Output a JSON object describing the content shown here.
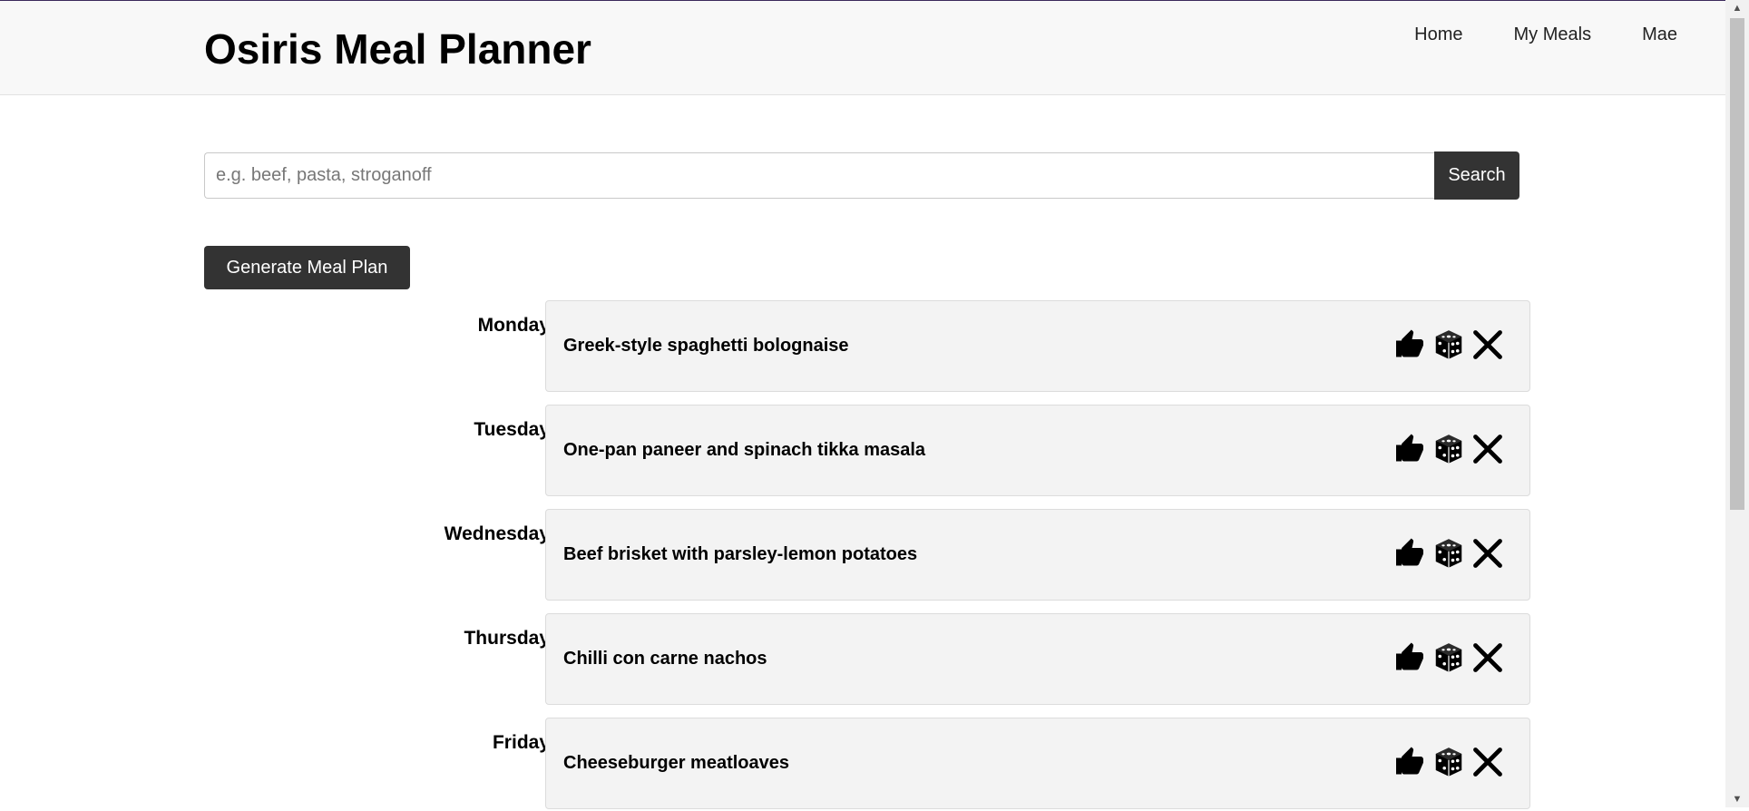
{
  "header": {
    "title": "Osiris Meal Planner",
    "nav": [
      "Home",
      "My Meals",
      "Mae"
    ]
  },
  "search": {
    "placeholder": "e.g. beef, pasta, stroganoff",
    "value": "",
    "button_label": "Search"
  },
  "generate_button": "Generate Meal Plan",
  "plan": [
    {
      "day": "Monday:",
      "meal": "Greek-style spaghetti bolognaise"
    },
    {
      "day": "Tuesday:",
      "meal": "One-pan paneer and spinach tikka masala"
    },
    {
      "day": "Wednesday:",
      "meal": "Beef brisket with parsley-lemon potatoes"
    },
    {
      "day": "Thursday:",
      "meal": "Chilli con carne nachos"
    },
    {
      "day": "Friday:",
      "meal": "Cheeseburger meatloaves"
    }
  ],
  "icons": {
    "like": "thumbs-up-icon",
    "reroll": "dice-icon",
    "remove": "close-icon"
  },
  "colors": {
    "button_bg": "#333333",
    "header_bg": "#f8f8f8",
    "card_bg": "#f3f3f3"
  }
}
